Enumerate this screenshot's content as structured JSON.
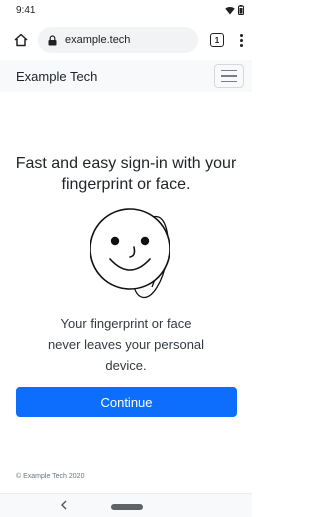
{
  "status_bar": {
    "time": "9:41"
  },
  "browser": {
    "url": "example.tech",
    "tab_count": "1"
  },
  "site": {
    "brand": "Example Tech"
  },
  "main": {
    "headline": "Fast and easy sign-in with your fingerprint or face.",
    "description": "Your fingerprint or face never leaves your personal device.",
    "continue_label": "Continue"
  },
  "footer": {
    "copyright": "© Example Tech 2020"
  },
  "colors": {
    "accent": "#0d6efd",
    "header_bg": "#f8f9fa",
    "url_bg": "#f1f3f4"
  },
  "icons": [
    "wifi-icon",
    "battery-icon",
    "home-icon",
    "lock-icon",
    "tab-switcher-icon",
    "more-vert-icon",
    "hamburger-icon",
    "face-fingerprint-illustration",
    "back-icon"
  ]
}
